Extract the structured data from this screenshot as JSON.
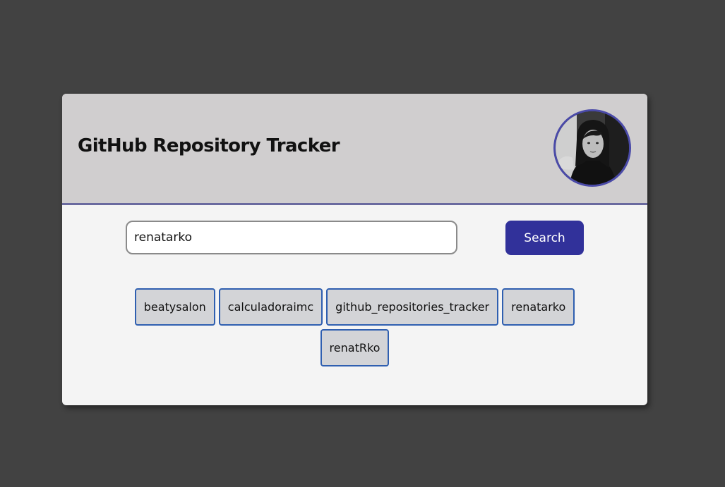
{
  "header": {
    "title": "GitHub Repository Tracker",
    "avatar_icon": "user-avatar-photo"
  },
  "search": {
    "value": "renatarko",
    "button_label": "Search"
  },
  "repositories": [
    "beatysalon",
    "calculadoraimc",
    "github_repositories_tracker",
    "renatarko",
    "renatRko"
  ],
  "colors": {
    "background": "#424242",
    "card": "#f4f4f4",
    "header": "#d0cecf",
    "accent": "#31319a",
    "repo_border": "#2f5fb0",
    "repo_bg": "#d3d4d7"
  }
}
